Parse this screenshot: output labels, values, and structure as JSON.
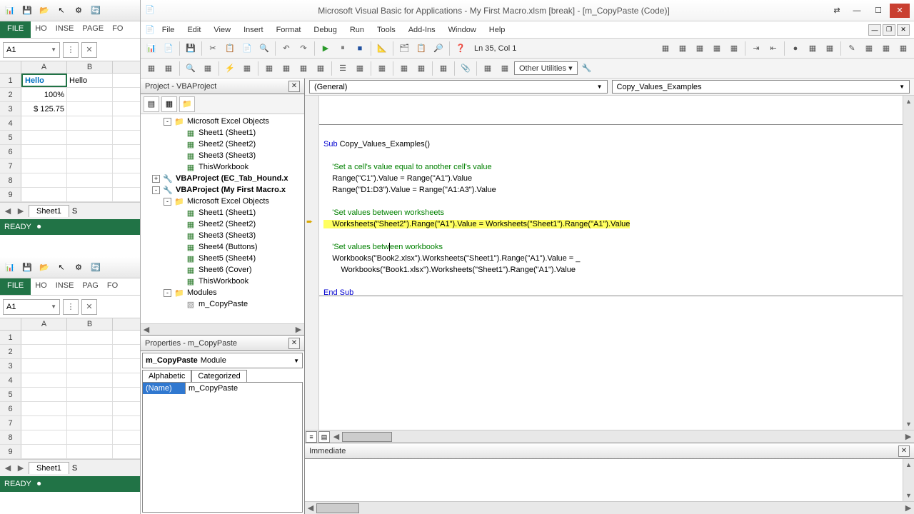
{
  "excel_top": {
    "file_tab": "FILE",
    "ribbon_tabs": [
      "HO",
      "INSE",
      "PAGE",
      "FO"
    ],
    "name_box": "A1",
    "cells": {
      "A1": "Hello",
      "A2": "100%",
      "A3": "$ 125.75",
      "B1": "Hello"
    },
    "cols": [
      "A",
      "B"
    ],
    "rows": [
      "1",
      "2",
      "3",
      "4",
      "5",
      "6",
      "7",
      "8",
      "9"
    ],
    "sheet": "Sheet1",
    "sheet_partial": "S",
    "status": "READY"
  },
  "excel_bottom": {
    "file_tab": "FILE",
    "ribbon_tabs": [
      "HO",
      "INSE",
      "PAG",
      "FO"
    ],
    "name_box": "A1",
    "cols": [
      "A",
      "B"
    ],
    "rows": [
      "1",
      "2",
      "3",
      "4",
      "5",
      "6",
      "7",
      "8",
      "9"
    ],
    "sheet": "Sheet1",
    "sheet_partial": "S",
    "status": "READY"
  },
  "vba": {
    "title": "Microsoft Visual Basic for Applications - My First Macro.xlsm [break] - [m_CopyPaste (Code)]",
    "menu": [
      "File",
      "Edit",
      "View",
      "Insert",
      "Format",
      "Debug",
      "Run",
      "Tools",
      "Add-Ins",
      "Window",
      "Help"
    ],
    "cursor_pos": "Ln 35, Col 1",
    "other_utilities": "Other Utilities",
    "project": {
      "title": "Project - VBAProject",
      "items": [
        {
          "level": 2,
          "exp": "-",
          "icon": "folder",
          "label": "Microsoft Excel Objects"
        },
        {
          "level": 3,
          "icon": "sheet",
          "label": "Sheet1 (Sheet1)"
        },
        {
          "level": 3,
          "icon": "sheet",
          "label": "Sheet2 (Sheet2)"
        },
        {
          "level": 3,
          "icon": "sheet",
          "label": "Sheet3 (Sheet3)"
        },
        {
          "level": 3,
          "icon": "sheet",
          "label": "ThisWorkbook"
        },
        {
          "level": 1,
          "exp": "+",
          "icon": "proj",
          "label": "VBAProject (EC_Tab_Hound.x",
          "bold": true
        },
        {
          "level": 1,
          "exp": "-",
          "icon": "proj",
          "label": "VBAProject (My First Macro.x",
          "bold": true
        },
        {
          "level": 2,
          "exp": "-",
          "icon": "folder",
          "label": "Microsoft Excel Objects"
        },
        {
          "level": 3,
          "icon": "sheet",
          "label": "Sheet1 (Sheet1)"
        },
        {
          "level": 3,
          "icon": "sheet",
          "label": "Sheet2 (Sheet2)"
        },
        {
          "level": 3,
          "icon": "sheet",
          "label": "Sheet3 (Sheet3)"
        },
        {
          "level": 3,
          "icon": "sheet",
          "label": "Sheet4 (Buttons)"
        },
        {
          "level": 3,
          "icon": "sheet",
          "label": "Sheet5 (Sheet4)"
        },
        {
          "level": 3,
          "icon": "sheet",
          "label": "Sheet6 (Cover)"
        },
        {
          "level": 3,
          "icon": "sheet",
          "label": "ThisWorkbook"
        },
        {
          "level": 2,
          "exp": "-",
          "icon": "folder",
          "label": "Modules"
        },
        {
          "level": 3,
          "icon": "module",
          "label": "m_CopyPaste"
        }
      ]
    },
    "properties": {
      "title": "Properties - m_CopyPaste",
      "combo_name": "m_CopyPaste",
      "combo_type": "Module",
      "tabs": [
        "Alphabetic",
        "Categorized"
      ],
      "prop_name": "(Name)",
      "prop_value": "m_CopyPaste"
    },
    "code": {
      "object_combo": "(General)",
      "procedure_combo": "Copy_Values_Examples",
      "lines": [
        "",
        "Sub Copy_Values_Examples()",
        "",
        "    'Set a cell's value equal to another cell's value",
        "    Range(\"C1\").Value = Range(\"A1\").Value",
        "    Range(\"D1:D3\").Value = Range(\"A1:A3\").Value",
        "    ",
        "    'Set values between worksheets",
        "    Worksheets(\"Sheet2\").Range(\"A1\").Value = Worksheets(\"Sheet1\").Range(\"A1\").Value",
        "    ",
        "    'Set values between workbooks",
        "    Workbooks(\"Book2.xlsx\").Worksheets(\"Sheet1\").Range(\"A1\").Value = _",
        "        Workbooks(\"Book1.xlsx\").Worksheets(\"Sheet1\").Range(\"A1\").Value",
        "",
        "End Sub"
      ],
      "highlight_line": 8,
      "cursor_line": 10
    },
    "immediate": {
      "title": "Immediate"
    }
  }
}
